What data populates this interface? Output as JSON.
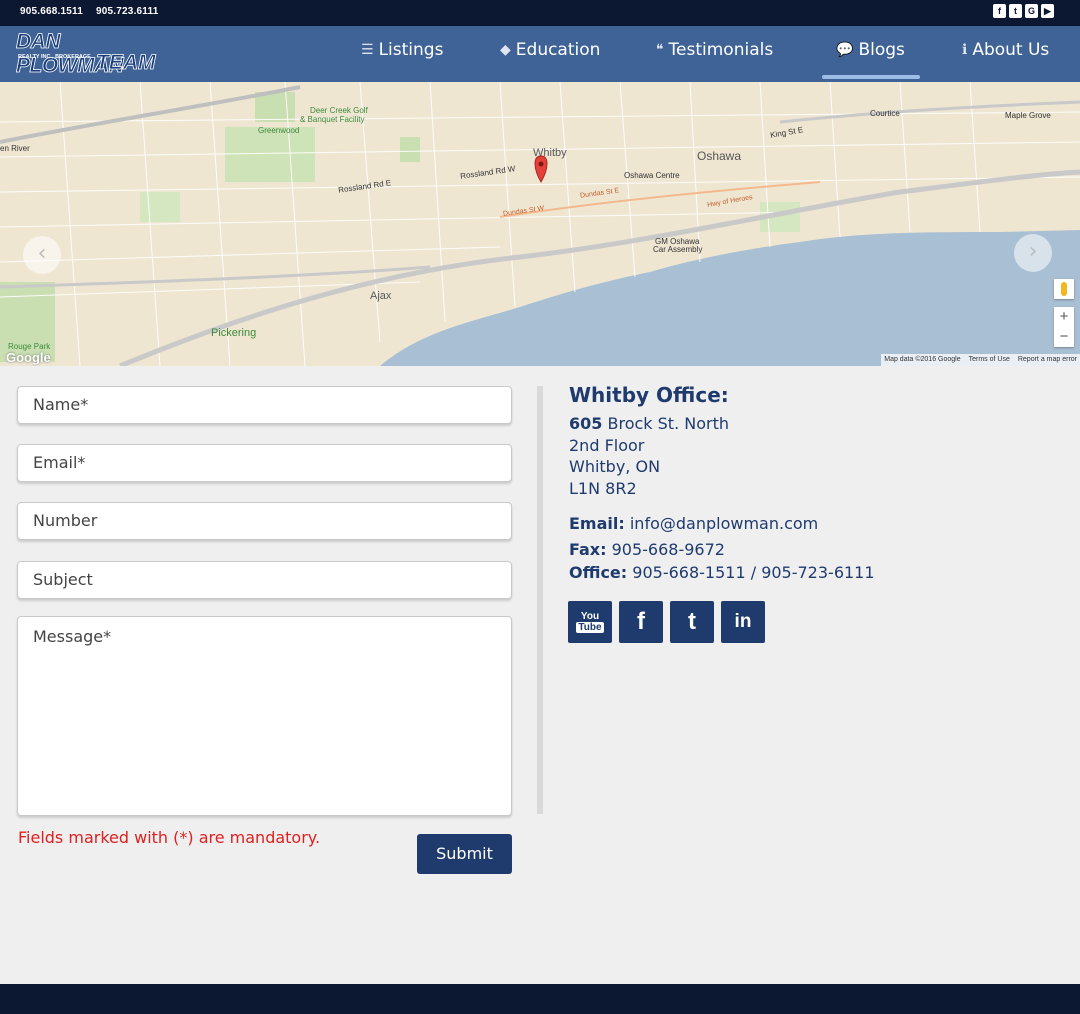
{
  "topbar": {
    "phone1": "905.668.1511",
    "phone2": "905.723.6111",
    "social_icons": [
      "facebook-icon",
      "twitter-icon",
      "google-plus-icon",
      "youtube-icon"
    ]
  },
  "logo": {
    "line1": "DAN PLOWMAN",
    "line2": "REALTY INC., BROKERAGE",
    "line3": "TEAM"
  },
  "nav": {
    "items": [
      {
        "label": "Listings",
        "icon": "list-icon",
        "active": false
      },
      {
        "label": "Education",
        "icon": "graduation-cap-icon",
        "active": false
      },
      {
        "label": "Testimonials",
        "icon": "quote-icon",
        "active": false
      },
      {
        "label": "Blogs",
        "icon": "comment-icon",
        "active": true
      },
      {
        "label": "About Us",
        "icon": "info-icon",
        "active": false
      }
    ]
  },
  "map": {
    "labels": {
      "deer_creek": "Deer Creek Golf",
      "deer_creek2": "& Banquet Facility",
      "greenwood": "Greenwood",
      "whitby": "Whitby",
      "oshawa": "Oshawa",
      "oshawa_centre": "Oshawa Centre",
      "gm_oshawa": "GM Oshawa",
      "car_assembly": "Car Assembly",
      "ajax": "Ajax",
      "pickering": "Pickering",
      "courtice": "Courtice",
      "maple_grove": "Maple Grove",
      "rouge_park": "Rouge Park",
      "dundas": "Dundas St W",
      "dundas_e": "Dundas St E",
      "hwy_heroes": "Hwy of Heroes",
      "rossland": "Rossland Rd W",
      "rossland_e": "Rossland Rd E",
      "green_river": "en River",
      "king_st": "King St E"
    },
    "attribution": {
      "data": "Map data ©2016 Google",
      "terms": "Terms of Use",
      "report": "Report a map error"
    },
    "google": "Google",
    "zoom_in": "+",
    "zoom_out": "−"
  },
  "form": {
    "name_placeholder": "Name*",
    "email_placeholder": "Email*",
    "number_placeholder": "Number",
    "subject_placeholder": "Subject",
    "message_placeholder": "Message*",
    "mandatory_note": "Fields marked with (*) are mandatory.",
    "submit_label": "Submit"
  },
  "office": {
    "title": "Whitby Office:",
    "street_number": "605",
    "street": "Brock St. North",
    "floor": "2nd Floor",
    "city": "Whitby, ON",
    "postal": "L1N 8R2",
    "email_label": "Email:",
    "email": "info@danplowman.com",
    "fax_label": "Fax:",
    "fax": "905-668-9672",
    "office_label": "Office:",
    "office_phones": "905-668-1511 / 905-723-6111"
  },
  "social": {
    "youtube_top": "You",
    "youtube_bottom": "Tube",
    "facebook": "f",
    "twitter": "t",
    "linkedin": "in"
  },
  "colors": {
    "navy": "#1f3b6e",
    "nav_bg": "#3f6396",
    "topbar_bg": "#0c1731",
    "mandatory_red": "#e02020"
  }
}
